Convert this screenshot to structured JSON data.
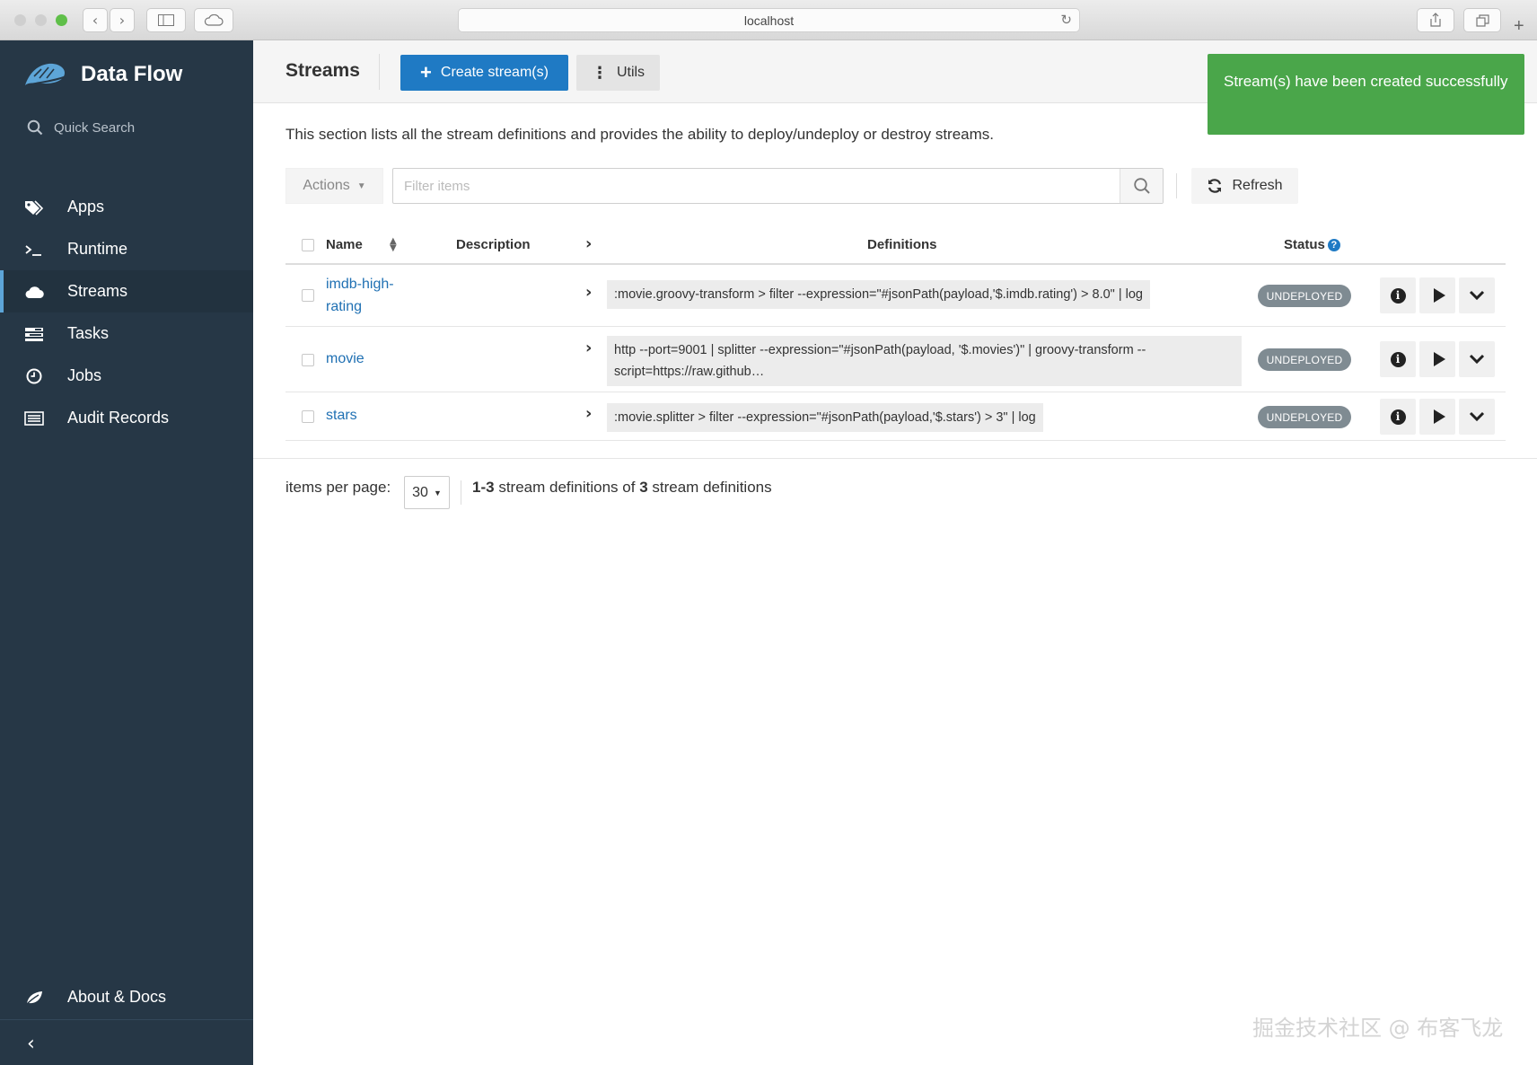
{
  "browser": {
    "url": "localhost"
  },
  "sidebar": {
    "brand": "Data Flow",
    "quick_search": "Quick Search",
    "items": [
      {
        "label": "Apps",
        "icon": "tags-icon"
      },
      {
        "label": "Runtime",
        "icon": "terminal-icon"
      },
      {
        "label": "Streams",
        "icon": "cloud-icon",
        "active": true
      },
      {
        "label": "Tasks",
        "icon": "tasks-icon"
      },
      {
        "label": "Jobs",
        "icon": "clock-icon"
      },
      {
        "label": "Audit Records",
        "icon": "list-icon"
      }
    ],
    "about": "About & Docs"
  },
  "header": {
    "title": "Streams",
    "create_label": "Create stream(s)",
    "utils_label": "Utils"
  },
  "toast": {
    "message": "Stream(s) have been created successfully",
    "color": "#4aa64a"
  },
  "main": {
    "description": "This section lists all the stream definitions and provides the ability to deploy/undeploy or destroy streams.",
    "actions_label": "Actions",
    "filter_placeholder": "Filter items",
    "refresh_label": "Refresh"
  },
  "table": {
    "columns": {
      "name": "Name",
      "description": "Description",
      "definitions": "Definitions",
      "status": "Status"
    },
    "rows": [
      {
        "name_line1": "imdb-high-",
        "name_line2": "rating",
        "definition": ":movie.groovy-transform > filter --expression=\"#jsonPath(payload,'$.imdb.rating') > 8.0\" | log",
        "status": "UNDEPLOYED"
      },
      {
        "name_line1": "movie",
        "definition_line1": "http --port=9001 | splitter --expression=\"#jsonPath(payload, '$.movies')\" | groovy-transform --",
        "definition_line2": "script=https://raw.github…",
        "status": "UNDEPLOYED"
      },
      {
        "name_line1": "stars",
        "definition": ":movie.splitter > filter --expression=\"#jsonPath(payload,'$.stars') > 3\" | log",
        "status": "UNDEPLOYED"
      }
    ]
  },
  "pagination": {
    "label": "items per page:",
    "per_page": "30",
    "range": "1-3",
    "text_mid": "stream definitions of",
    "total": "3",
    "text_end": "stream definitions"
  },
  "watermark": "掘金技术社区 @ 布客飞龙",
  "colors": {
    "sidebar_bg": "#263746",
    "primary": "#1f7ac4",
    "link": "#1f70b3",
    "status_badge": "#7f8b92"
  }
}
